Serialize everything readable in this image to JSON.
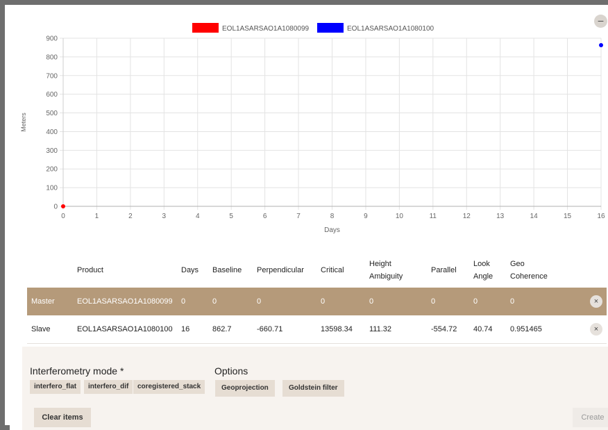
{
  "chart_data": {
    "type": "scatter",
    "xlabel": "Days",
    "ylabel": "Meters",
    "xlim": [
      0,
      16
    ],
    "ylim": [
      0,
      900
    ],
    "xticks": [
      "0",
      "1",
      "2",
      "3",
      "4",
      "5",
      "6",
      "7",
      "8",
      "9",
      "10",
      "11",
      "12",
      "13",
      "14",
      "15",
      "16"
    ],
    "yticks": [
      "0",
      "100",
      "200",
      "300",
      "400",
      "500",
      "600",
      "700",
      "800",
      "900"
    ],
    "grid": true,
    "legend_position": "top-center",
    "series": [
      {
        "name": "EOL1ASARSAO1A1080099",
        "color": "#ff0000",
        "points": [
          {
            "x": 0,
            "y": 0
          }
        ]
      },
      {
        "name": "EOL1ASARSAO1A1080100",
        "color": "#0000ff",
        "points": [
          {
            "x": 16,
            "y": 862.7
          }
        ]
      }
    ]
  },
  "collapse_symbol": "–",
  "table": {
    "headers": [
      "",
      "Product",
      "Days",
      "Baseline",
      "Perpendicular",
      "Critical",
      "Height Ambiguity",
      "Parallel",
      "Look Angle",
      "Geo Coherence"
    ],
    "rows": [
      {
        "role": "Master",
        "product": "EOL1ASARSAO1A1080099",
        "days": "0",
        "baseline": "0",
        "perpendicular": "0",
        "critical": "0",
        "height_ambiguity": "0",
        "parallel": "0",
        "look_angle": "0",
        "geo_coherence": "0"
      },
      {
        "role": "Slave",
        "product": "EOL1ASARSAO1A1080100",
        "days": "16",
        "baseline": "862.7",
        "perpendicular": "-660.71",
        "critical": "13598.34",
        "height_ambiguity": "111.32",
        "parallel": "-554.72",
        "look_angle": "40.74",
        "geo_coherence": "0.951465"
      }
    ],
    "remove_symbol": "×"
  },
  "interferometry": {
    "title": "Interferometry mode *",
    "modes": [
      "interfero_flat",
      "interfero_dif",
      "coregistered_stack"
    ]
  },
  "options": {
    "title": "Options",
    "items": [
      "Geoprojection",
      "Goldstein filter"
    ]
  },
  "buttons": {
    "clear": "Clear items",
    "create": "Create"
  }
}
